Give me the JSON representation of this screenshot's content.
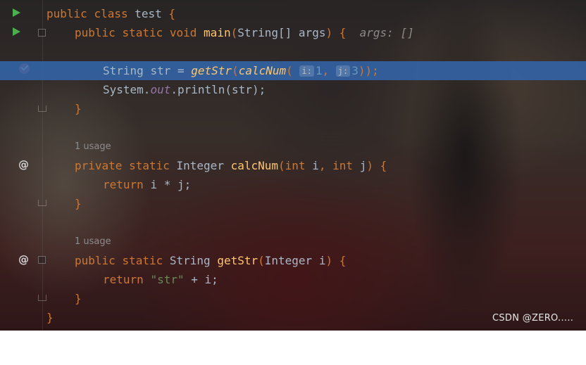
{
  "lines": {
    "l1": [
      "public",
      "class",
      "test",
      "{"
    ],
    "l2": [
      "public",
      "static",
      "void",
      "main",
      "(",
      "String[]",
      "args",
      ")",
      "{",
      "args: []"
    ],
    "l4": [
      "String",
      "str",
      "=",
      "getStr",
      "(",
      "calcNum",
      "(",
      "i:",
      "1",
      ",",
      "j:",
      "3",
      "));"
    ],
    "l5": [
      "System",
      ".",
      "out",
      ".println(str);"
    ],
    "l6": [
      "}"
    ],
    "usage1": "1 usage",
    "l8": [
      "private",
      "static",
      "Integer",
      "calcNum",
      "(",
      "int",
      "i",
      ",",
      "int",
      "j",
      ")",
      "{"
    ],
    "l9": [
      "return",
      "i * j;"
    ],
    "l10": [
      "}"
    ],
    "usage2": "1 usage",
    "l12": [
      "public",
      "static",
      "String",
      "getStr",
      "(",
      "Integer i",
      ")",
      "{"
    ],
    "l13": [
      "return",
      "\"str\"",
      "+ i;"
    ],
    "l14": [
      "}"
    ],
    "l15": [
      "}"
    ]
  },
  "gutter": {
    "run_icon": "run-triangle-icon",
    "breakpoint_icon": "breakpoint-check-icon",
    "override_icon": "@"
  },
  "watermark": "CSDN @ZERO.....",
  "colors": {
    "keyword": "#cc7832",
    "function": "#ffc66d",
    "string": "#6a8759",
    "number": "#6897bb",
    "field": "#9876aa",
    "plain": "#a9b7c6",
    "highlight": "#3264a8"
  }
}
